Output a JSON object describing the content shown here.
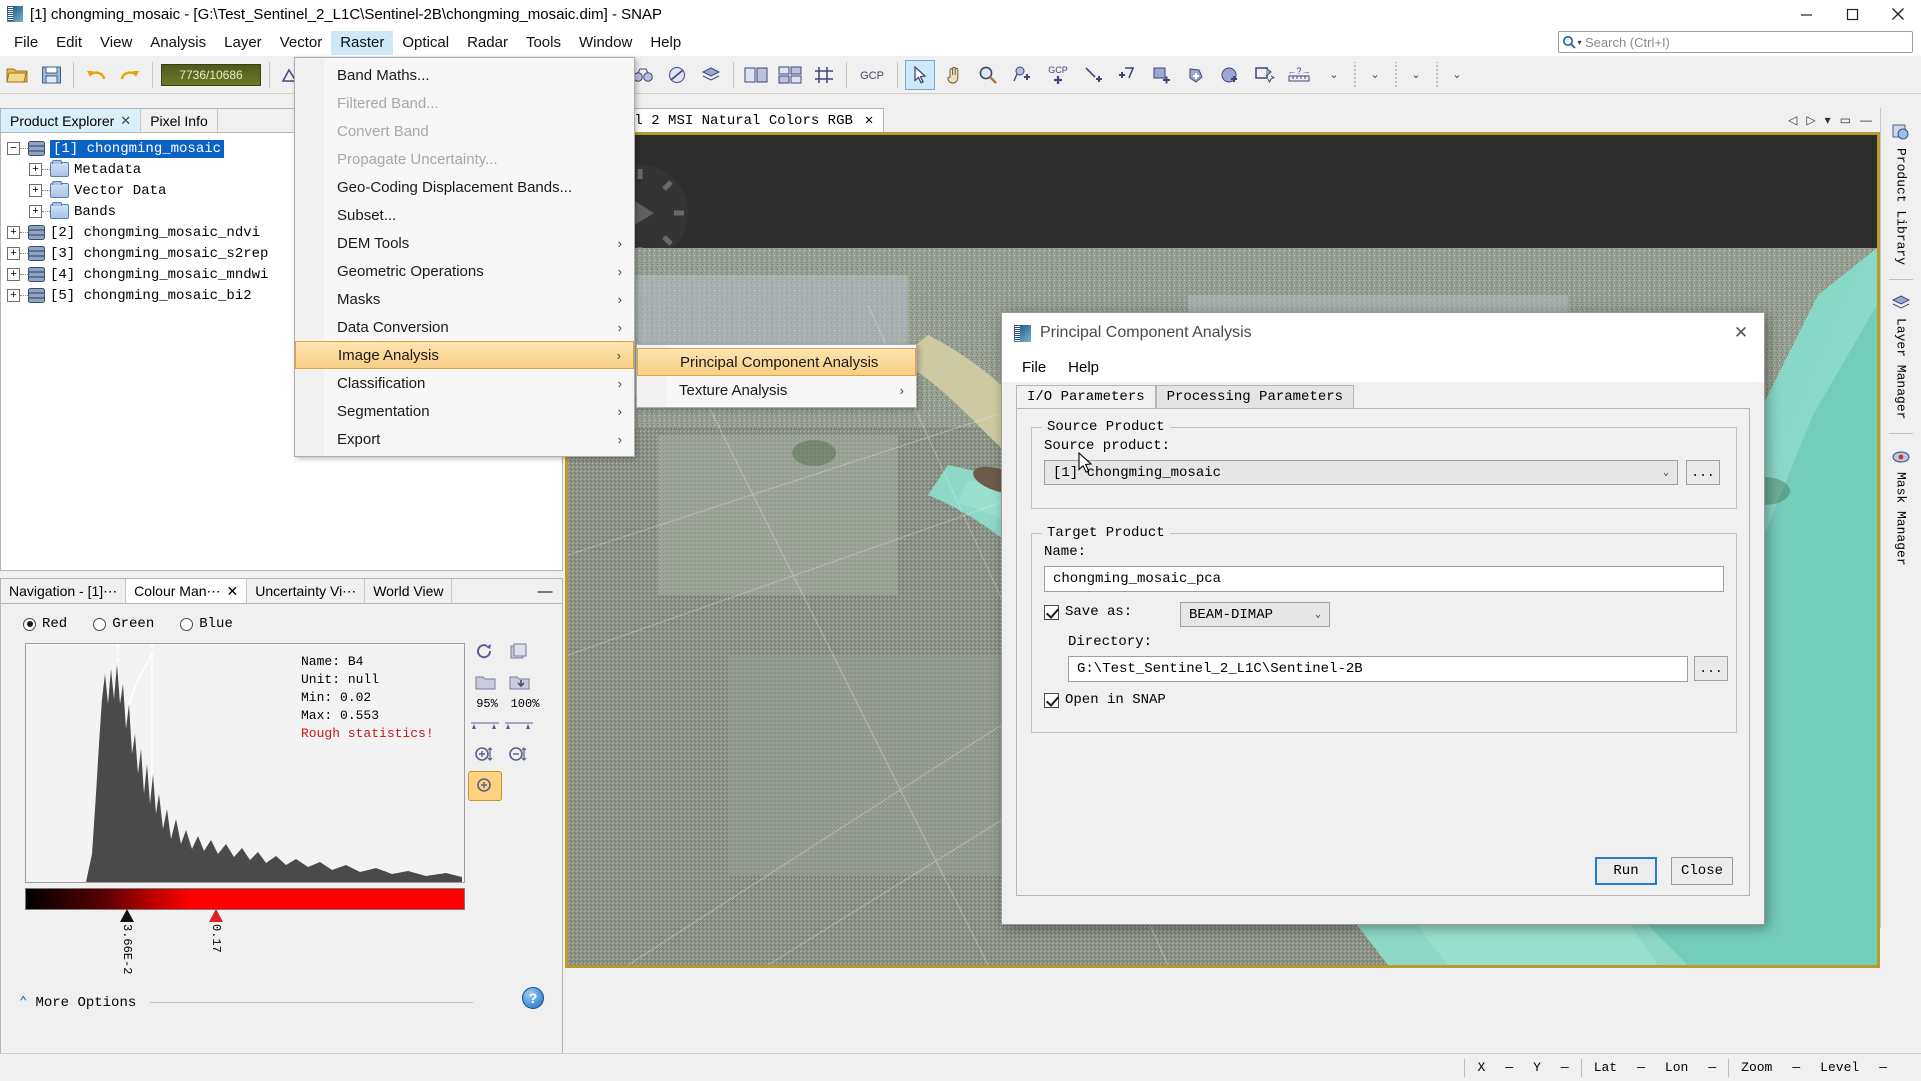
{
  "window": {
    "title": "[1] chongming_mosaic - [G:\\Test_Sentinel_2_L1C\\Sentinel-2B\\chongming_mosaic.dim] - SNAP",
    "minimize": "—",
    "maximize": "□",
    "close": "✕"
  },
  "menubar": {
    "items": [
      "File",
      "Edit",
      "View",
      "Analysis",
      "Layer",
      "Vector",
      "Raster",
      "Optical",
      "Radar",
      "Tools",
      "Window",
      "Help"
    ],
    "active": "Raster"
  },
  "search": {
    "placeholder": "Search (Ctrl+I)",
    "icon": "search-icon"
  },
  "toolbar": {
    "progress_label": "7736/10686",
    "icons": [
      "open-product-icon",
      "save-product-icon",
      "undo-icon",
      "redo-icon",
      "colour-manipulation-icon",
      "geo-coding-icon",
      "profile-plot-icon",
      "information-icon",
      "histogram-icon",
      "scatter-plot-icon",
      "sum-icon",
      "mask-manager-icon",
      "layer-manager-icon",
      "no-data-icon",
      "navigation-icon",
      "tile-horizontally-icon",
      "tile-evenly-icon",
      "grid-icon",
      "gcp-manager-icon",
      "selection-tool-icon",
      "pan-tool-icon",
      "zoom-tool-icon",
      "pin-placing-icon",
      "gcp-placing-icon",
      "line-drawing-icon",
      "polyline-drawing-icon",
      "rectangle-drawing-icon",
      "polygon-drawing-icon",
      "ellipse-drawing-icon",
      "magic-wand-icon",
      "range-finder-icon",
      "chevron-down-icon"
    ]
  },
  "product_explorer": {
    "tabs": [
      {
        "label": "Product Explorer",
        "closable": true,
        "active": true
      },
      {
        "label": "Pixel Info",
        "closable": false,
        "active": false
      }
    ],
    "tree": [
      {
        "label": "[1] chongming_mosaic",
        "type": "product",
        "expanded": true,
        "selected": true,
        "level": 0
      },
      {
        "label": "Metadata",
        "type": "folder",
        "expanded": false,
        "selected": false,
        "level": 1
      },
      {
        "label": "Vector Data",
        "type": "folder",
        "expanded": false,
        "selected": false,
        "level": 1
      },
      {
        "label": "Bands",
        "type": "folder",
        "expanded": false,
        "selected": false,
        "level": 1
      },
      {
        "label": "[2] chongming_mosaic_ndvi",
        "type": "product",
        "expanded": false,
        "selected": false,
        "level": 0
      },
      {
        "label": "[3] chongming_mosaic_s2rep",
        "type": "product",
        "expanded": false,
        "selected": false,
        "level": 0
      },
      {
        "label": "[4] chongming_mosaic_mndwi",
        "type": "product",
        "expanded": false,
        "selected": false,
        "level": 0
      },
      {
        "label": "[5] chongming_mosaic_bi2",
        "type": "product",
        "expanded": false,
        "selected": false,
        "level": 0
      }
    ]
  },
  "colour_panel": {
    "tabs": [
      {
        "label": "Navigation - [1]⋯",
        "closable": false,
        "active": false
      },
      {
        "label": "Colour Man⋯",
        "closable": true,
        "active": true
      },
      {
        "label": "Uncertainty Vi⋯",
        "closable": false,
        "active": false
      },
      {
        "label": "World View",
        "closable": false,
        "active": false
      }
    ],
    "minimize": "—",
    "channels": [
      {
        "label": "Red",
        "selected": true
      },
      {
        "label": "Green",
        "selected": false
      },
      {
        "label": "Blue",
        "selected": false
      }
    ],
    "stats": {
      "name_label": "Name:",
      "name_value": "B4",
      "unit_label": "Unit:",
      "unit_value": "null",
      "min_label": "Min:",
      "min_value": "0.02",
      "max_label": "Max:",
      "max_value": "0.553",
      "rough": "Rough statistics!"
    },
    "sliders": {
      "left_label": "3.66E-2",
      "right_label": "0.17"
    },
    "side_buttons": {
      "reset": "reset-icon",
      "multi_apply": "multi-apply-icon",
      "import": "import-icon",
      "export": "export-icon",
      "p95": "95%",
      "p100": "100%",
      "zoom_in_v": "zoom-in-vertical-icon",
      "zoom_out_v": "zoom-out-vertical-icon",
      "zoom_in_h": "zoom-in-horizontal-icon"
    },
    "more_options": "More Options",
    "help": "?"
  },
  "raster_menu": {
    "items": [
      {
        "label": "Band Maths...",
        "disabled": false,
        "submenu": false,
        "hover": false
      },
      {
        "label": "Filtered Band...",
        "disabled": true,
        "submenu": false,
        "hover": false
      },
      {
        "label": "Convert Band",
        "disabled": true,
        "submenu": false,
        "hover": false
      },
      {
        "label": "Propagate Uncertainty...",
        "disabled": true,
        "submenu": false,
        "hover": false
      },
      {
        "label": "Geo-Coding Displacement Bands...",
        "disabled": false,
        "submenu": false,
        "hover": false
      },
      {
        "label": "Subset...",
        "disabled": false,
        "submenu": false,
        "hover": false
      },
      {
        "label": "DEM Tools",
        "disabled": false,
        "submenu": true,
        "hover": false
      },
      {
        "label": "Geometric Operations",
        "disabled": false,
        "submenu": true,
        "hover": false
      },
      {
        "label": "Masks",
        "disabled": false,
        "submenu": true,
        "hover": false
      },
      {
        "label": "Data Conversion",
        "disabled": false,
        "submenu": true,
        "hover": false
      },
      {
        "label": "Image Analysis",
        "disabled": false,
        "submenu": true,
        "hover": true
      },
      {
        "label": "Classification",
        "disabled": false,
        "submenu": true,
        "hover": false
      },
      {
        "label": "Segmentation",
        "disabled": false,
        "submenu": true,
        "hover": false
      },
      {
        "label": "Export",
        "disabled": false,
        "submenu": true,
        "hover": false
      }
    ]
  },
  "image_analysis_submenu": {
    "items": [
      {
        "label": "Principal Component Analysis",
        "submenu": false,
        "hover": true
      },
      {
        "label": "Texture Analysis",
        "submenu": true,
        "hover": false
      }
    ]
  },
  "view_tab": {
    "label": "⋯ntinel 2 MSI Natural Colors RGB",
    "close": "✕"
  },
  "right_dock": {
    "items": [
      {
        "label": "Product Library",
        "icon": "product-library-icon"
      },
      {
        "label": "Layer Manager",
        "icon": "layer-manager-icon"
      },
      {
        "label": "Mask Manager",
        "icon": "mask-manager-icon"
      }
    ]
  },
  "statusbar": {
    "x_label": "X",
    "x_value": "—",
    "y_label": "Y",
    "y_value": "—",
    "lat_label": "Lat",
    "lat_value": "—",
    "lon_label": "Lon",
    "lon_value": "—",
    "zoom_label": "Zoom",
    "zoom_value": "—",
    "level_label": "Level",
    "level_value": "—"
  },
  "dialog": {
    "title": "Principal Component Analysis",
    "close": "✕",
    "menu": [
      "File",
      "Help"
    ],
    "tabs": [
      {
        "label": "I/O Parameters",
        "active": true
      },
      {
        "label": "Processing Parameters",
        "active": false
      }
    ],
    "source_group": {
      "title": "Source Product",
      "field_label": "Source product:",
      "value": "[1] chongming_mosaic",
      "browse": "...",
      "arrow": "⌄"
    },
    "target_group": {
      "title": "Target Product",
      "name_label": "Name:",
      "name_value": "chongming_mosaic_pca",
      "save_as_label": "Save as:",
      "save_as_value": "BEAM-DIMAP",
      "save_as_checked": true,
      "directory_label": "Directory:",
      "directory_value": "G:\\Test_Sentinel_2_L1C\\Sentinel-2B",
      "directory_browse": "...",
      "open_in_snap_label": "Open in SNAP",
      "open_in_snap_checked": true
    },
    "buttons": {
      "run": "Run",
      "close": "Close"
    }
  },
  "colors": {
    "accent_blue": "#0a62c7",
    "menu_hover": "#f8cf86",
    "tab_active": "#cde8f7",
    "red_ramp": "#ff0000",
    "rough_stats": "#c21a1a",
    "image_border": "#b99a2e"
  }
}
